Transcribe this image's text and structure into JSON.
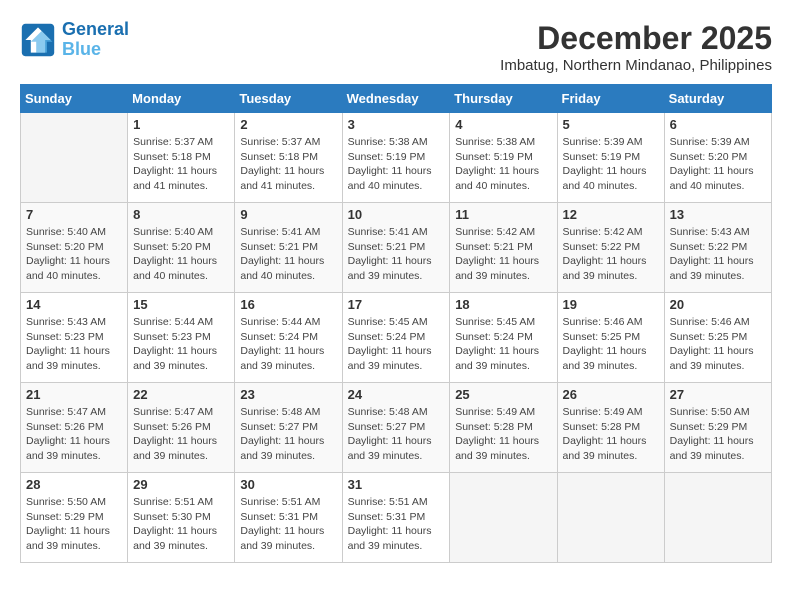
{
  "logo": {
    "line1": "General",
    "line2": "Blue"
  },
  "title": {
    "month": "December 2025",
    "location": "Imbatug, Northern Mindanao, Philippines"
  },
  "headers": [
    "Sunday",
    "Monday",
    "Tuesday",
    "Wednesday",
    "Thursday",
    "Friday",
    "Saturday"
  ],
  "weeks": [
    [
      {
        "day": "",
        "empty": true
      },
      {
        "day": "1",
        "sunrise": "5:37 AM",
        "sunset": "5:18 PM",
        "daylight": "11 hours and 41 minutes."
      },
      {
        "day": "2",
        "sunrise": "5:37 AM",
        "sunset": "5:18 PM",
        "daylight": "11 hours and 41 minutes."
      },
      {
        "day": "3",
        "sunrise": "5:38 AM",
        "sunset": "5:19 PM",
        "daylight": "11 hours and 40 minutes."
      },
      {
        "day": "4",
        "sunrise": "5:38 AM",
        "sunset": "5:19 PM",
        "daylight": "11 hours and 40 minutes."
      },
      {
        "day": "5",
        "sunrise": "5:39 AM",
        "sunset": "5:19 PM",
        "daylight": "11 hours and 40 minutes."
      },
      {
        "day": "6",
        "sunrise": "5:39 AM",
        "sunset": "5:20 PM",
        "daylight": "11 hours and 40 minutes."
      }
    ],
    [
      {
        "day": "7",
        "sunrise": "5:40 AM",
        "sunset": "5:20 PM",
        "daylight": "11 hours and 40 minutes."
      },
      {
        "day": "8",
        "sunrise": "5:40 AM",
        "sunset": "5:20 PM",
        "daylight": "11 hours and 40 minutes."
      },
      {
        "day": "9",
        "sunrise": "5:41 AM",
        "sunset": "5:21 PM",
        "daylight": "11 hours and 40 minutes."
      },
      {
        "day": "10",
        "sunrise": "5:41 AM",
        "sunset": "5:21 PM",
        "daylight": "11 hours and 39 minutes."
      },
      {
        "day": "11",
        "sunrise": "5:42 AM",
        "sunset": "5:21 PM",
        "daylight": "11 hours and 39 minutes."
      },
      {
        "day": "12",
        "sunrise": "5:42 AM",
        "sunset": "5:22 PM",
        "daylight": "11 hours and 39 minutes."
      },
      {
        "day": "13",
        "sunrise": "5:43 AM",
        "sunset": "5:22 PM",
        "daylight": "11 hours and 39 minutes."
      }
    ],
    [
      {
        "day": "14",
        "sunrise": "5:43 AM",
        "sunset": "5:23 PM",
        "daylight": "11 hours and 39 minutes."
      },
      {
        "day": "15",
        "sunrise": "5:44 AM",
        "sunset": "5:23 PM",
        "daylight": "11 hours and 39 minutes."
      },
      {
        "day": "16",
        "sunrise": "5:44 AM",
        "sunset": "5:24 PM",
        "daylight": "11 hours and 39 minutes."
      },
      {
        "day": "17",
        "sunrise": "5:45 AM",
        "sunset": "5:24 PM",
        "daylight": "11 hours and 39 minutes."
      },
      {
        "day": "18",
        "sunrise": "5:45 AM",
        "sunset": "5:24 PM",
        "daylight": "11 hours and 39 minutes."
      },
      {
        "day": "19",
        "sunrise": "5:46 AM",
        "sunset": "5:25 PM",
        "daylight": "11 hours and 39 minutes."
      },
      {
        "day": "20",
        "sunrise": "5:46 AM",
        "sunset": "5:25 PM",
        "daylight": "11 hours and 39 minutes."
      }
    ],
    [
      {
        "day": "21",
        "sunrise": "5:47 AM",
        "sunset": "5:26 PM",
        "daylight": "11 hours and 39 minutes."
      },
      {
        "day": "22",
        "sunrise": "5:47 AM",
        "sunset": "5:26 PM",
        "daylight": "11 hours and 39 minutes."
      },
      {
        "day": "23",
        "sunrise": "5:48 AM",
        "sunset": "5:27 PM",
        "daylight": "11 hours and 39 minutes."
      },
      {
        "day": "24",
        "sunrise": "5:48 AM",
        "sunset": "5:27 PM",
        "daylight": "11 hours and 39 minutes."
      },
      {
        "day": "25",
        "sunrise": "5:49 AM",
        "sunset": "5:28 PM",
        "daylight": "11 hours and 39 minutes."
      },
      {
        "day": "26",
        "sunrise": "5:49 AM",
        "sunset": "5:28 PM",
        "daylight": "11 hours and 39 minutes."
      },
      {
        "day": "27",
        "sunrise": "5:50 AM",
        "sunset": "5:29 PM",
        "daylight": "11 hours and 39 minutes."
      }
    ],
    [
      {
        "day": "28",
        "sunrise": "5:50 AM",
        "sunset": "5:29 PM",
        "daylight": "11 hours and 39 minutes."
      },
      {
        "day": "29",
        "sunrise": "5:51 AM",
        "sunset": "5:30 PM",
        "daylight": "11 hours and 39 minutes."
      },
      {
        "day": "30",
        "sunrise": "5:51 AM",
        "sunset": "5:31 PM",
        "daylight": "11 hours and 39 minutes."
      },
      {
        "day": "31",
        "sunrise": "5:51 AM",
        "sunset": "5:31 PM",
        "daylight": "11 hours and 39 minutes."
      },
      {
        "day": "",
        "empty": true
      },
      {
        "day": "",
        "empty": true
      },
      {
        "day": "",
        "empty": true
      }
    ]
  ],
  "cell_labels": {
    "sunrise_label": "Sunrise: ",
    "sunset_label": "Sunset: ",
    "daylight_label": "Daylight: "
  }
}
